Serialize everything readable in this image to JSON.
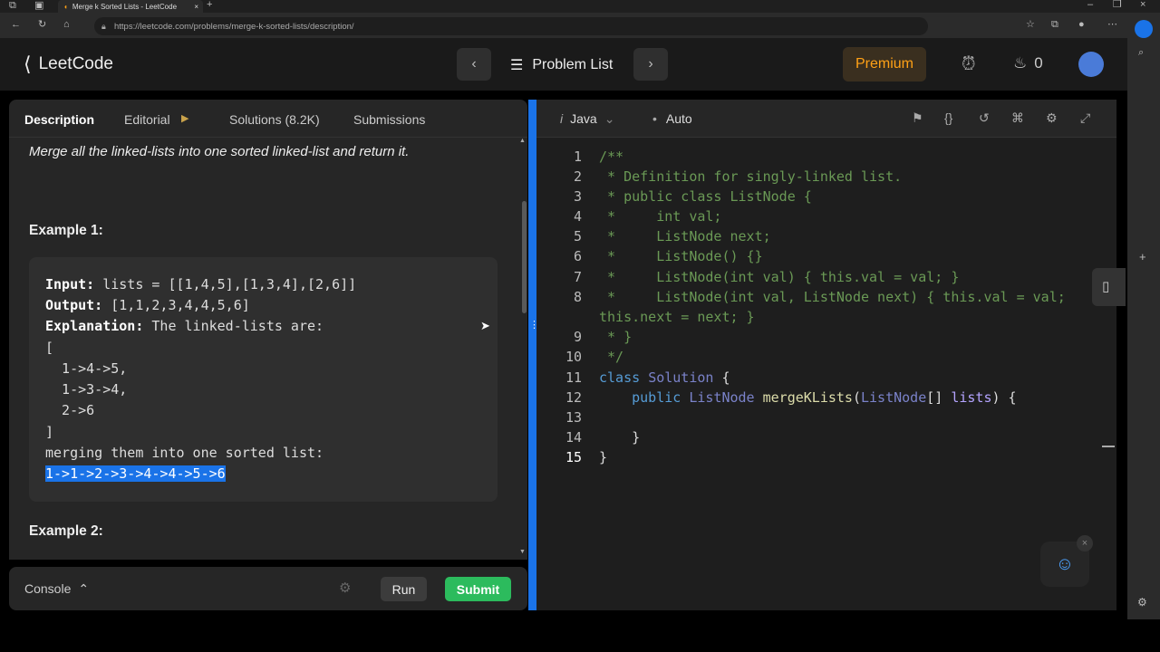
{
  "browser": {
    "tab_title": "Merge k Sorted Lists - LeetCode",
    "url": "https://leetcode.com/problems/merge-k-sorted-lists/description/"
  },
  "nav": {
    "brand": "LeetCode",
    "problem_list": "Problem List",
    "premium": "Premium",
    "streak_count": "0"
  },
  "tabs": [
    {
      "label": "Description"
    },
    {
      "label": "Editorial"
    },
    {
      "label": "Solutions (8.2K)"
    },
    {
      "label": "Submissions"
    }
  ],
  "description": {
    "intro": "Merge all the linked-lists into one sorted linked-list and return it.",
    "example1_title": "Example 1:",
    "example2_title": "Example 2:",
    "input_label": "Input:",
    "input_value": " lists = [[1,4,5],[1,3,4],[2,6]]",
    "output_label": "Output:",
    "output_value": " [1,1,2,3,4,4,5,6]",
    "explanation_label": "Explanation:",
    "explanation_value": " The linked-lists are:",
    "lines": [
      "[",
      "  1->4->5,",
      "  1->3->4,",
      "  2->6",
      "]",
      "merging them into one sorted list:"
    ],
    "result": "1->1->2->3->4->4->5->6"
  },
  "console": {
    "label": "Console",
    "run": "Run",
    "submit": "Submit"
  },
  "editor": {
    "language": "Java",
    "mode": "Auto",
    "line_numbers": [
      "1",
      "2",
      "3",
      "4",
      "5",
      "6",
      "7",
      "8",
      "",
      "9",
      "10",
      "11",
      "12",
      "13",
      "14",
      "15"
    ]
  },
  "colors": {
    "accent_blue": "#1a73e8",
    "submit_green": "#2cbb5d",
    "premium_orange": "#ffa116"
  }
}
